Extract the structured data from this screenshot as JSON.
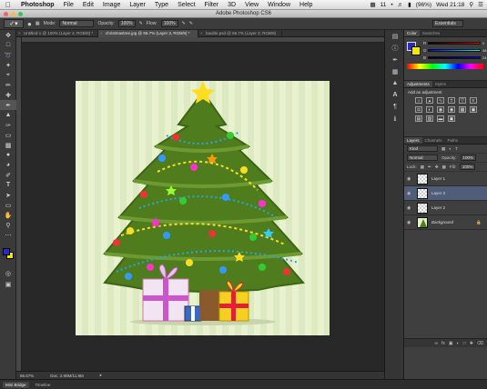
{
  "menubar": {
    "app_name": "Photoshop",
    "items": [
      "File",
      "Edit",
      "Image",
      "Layer",
      "Type",
      "Select",
      "Filter",
      "3D",
      "View",
      "Window",
      "Help"
    ],
    "status": {
      "battery": "(96%)",
      "clock": "Wed 21:18",
      "badge": "11"
    }
  },
  "window": {
    "title": "Adobe Photoshop CS6"
  },
  "options": {
    "mode_label": "Mode:",
    "mode_value": "Normal",
    "opacity_label": "Opacity:",
    "opacity_value": "100%",
    "flow_label": "Flow:",
    "flow_value": "100%",
    "workspace": "Essentials"
  },
  "doc_tabs": [
    {
      "label": "Untitled-1 @ 100% (Layer 2, RGB/8) *"
    },
    {
      "label": "christmastree.jpg @ 66.7% (Layer 3, RGB/8) *"
    },
    {
      "label": "bauble.psd @ 66.7% (Layer 3, RGB/8)"
    }
  ],
  "status_bar": {
    "zoom": "66.67%",
    "doc_info": "Doc: 2.90M/11.9M"
  },
  "bottom_tabs": [
    "Mini Bridge",
    "Timeline"
  ],
  "panels": {
    "color_tabs": [
      "Color",
      "Swatches"
    ],
    "color": {
      "r_label": "R",
      "g_label": "G",
      "b_label": "B",
      "r": "0",
      "g": "48",
      "b": "243",
      "fg": "#2a2ac8",
      "bg": "#f5e800"
    },
    "adjust_tabs": [
      "Adjustments",
      "Styles"
    ],
    "adjust_caption": "Add an adjustment",
    "layers_tabs": [
      "Layers",
      "Channels",
      "Paths"
    ],
    "blend_mode": "Normal",
    "opacity_label": "Opacity:",
    "opacity_value": "100%",
    "lock_label": "Lock:",
    "fill_label": "Fill:",
    "fill_value": "100%",
    "kind_label": "Kind",
    "layers": [
      {
        "name": "Layer 1",
        "active": false
      },
      {
        "name": "Layer 3",
        "active": true
      },
      {
        "name": "Layer 2",
        "active": false
      },
      {
        "name": "Background",
        "active": false
      }
    ]
  }
}
